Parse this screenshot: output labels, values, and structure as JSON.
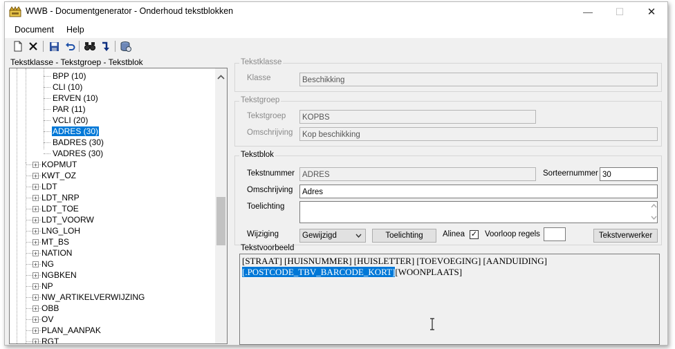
{
  "window": {
    "title": "WWB - Documentgenerator - Onderhoud tekstblokken",
    "minimize_glyph": "—",
    "maximize_glyph": "☐",
    "close_glyph": "✕"
  },
  "menu": {
    "items": [
      "Document",
      "Help"
    ]
  },
  "toolbar": {
    "icons": [
      "new-document-icon",
      "delete-icon",
      "save-icon",
      "undo-icon",
      "find-icon",
      "jump-icon",
      "database-icon"
    ]
  },
  "tree": {
    "label": "Tekstklasse - Tekstgroep - Tekstblok",
    "children": [
      "BPP (10)",
      "CLI (10)",
      "ERVEN (10)",
      "PAR (11)",
      "VCLI (20)",
      "ADRES (30)",
      "BADRES (30)",
      "VADRES (30)"
    ],
    "selected_child": "ADRES (30)",
    "groups": [
      "KOPMUT",
      "KWT_OZ",
      "LDT",
      "LDT_NRP",
      "LDT_TOE",
      "LDT_VOORW",
      "LNG_LOH",
      "MT_BS",
      "NATION",
      "NG",
      "NGBKEN",
      "NP",
      "NW_ARTIKELVERWIJZING",
      "OBB",
      "OV",
      "PLAN_AANPAK",
      "RGT"
    ],
    "expander_glyph": "+"
  },
  "tekstklasse": {
    "title": "Tekstklasse",
    "klasse_label": "Klasse",
    "klasse_value": "Beschikking"
  },
  "tekstgroep": {
    "title": "Tekstgroep",
    "groep_label": "Tekstgroep",
    "groep_value": "KOPBS",
    "omschrijving_label": "Omschrijving",
    "omschrijving_value": "Kop beschikking"
  },
  "tekstblok": {
    "title": "Tekstblok",
    "nummer_label": "Tekstnummer",
    "nummer_value": "ADRES",
    "sorteer_label": "Sorteernummer",
    "sorteer_value": "30",
    "omschrijving_label": "Omschrijving",
    "omschrijving_value": "Adres",
    "toelichting_label": "Toelichting",
    "toelichting_value": "",
    "wijziging_label": "Wijziging",
    "wijziging_value": "Gewijzigd",
    "toelichting_button": "Toelichting",
    "alinea_label": "Alinea",
    "alinea_checked": true,
    "check_glyph": "✓",
    "voorloop_label": "Voorloop regels",
    "voorloop_value": "",
    "tekstverwerker_button": "Tekstverwerker"
  },
  "voorbeeld": {
    "title": "Tekstvoorbeeld",
    "line1": "[STRAAT] [HUISNUMMER] [HUISLETTER] [TOEVOEGING] [AANDUIDING]",
    "line2_selected": "[.POSTCODE_TBV_BARCODE_KORT]",
    "line2_rest": "[WOONPLAATS]"
  }
}
